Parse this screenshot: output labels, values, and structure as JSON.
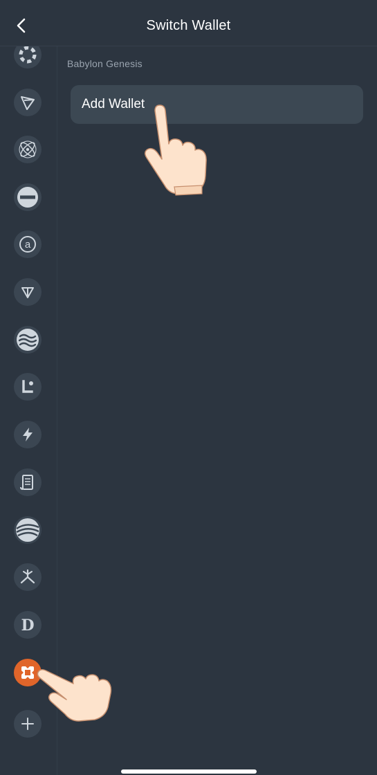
{
  "header": {
    "title": "Switch Wallet",
    "back_icon": "chevron-left-icon"
  },
  "sidebar": {
    "items": [
      {
        "name": "polkadot-icon",
        "active": false
      },
      {
        "name": "tron-icon",
        "active": false
      },
      {
        "name": "cosmos-atom-icon",
        "active": false
      },
      {
        "name": "minus-circle-icon",
        "active": false
      },
      {
        "name": "at-sign-icon",
        "active": false
      },
      {
        "name": "ton-triangle-icon",
        "active": false
      },
      {
        "name": "waves-icon",
        "active": false
      },
      {
        "name": "lisk-icon",
        "active": false
      },
      {
        "name": "lightning-icon",
        "active": false
      },
      {
        "name": "scroll-icon",
        "active": false
      },
      {
        "name": "swoosh-icon",
        "active": false
      },
      {
        "name": "propeller-icon",
        "active": false
      },
      {
        "name": "dogecoin-d-icon",
        "active": false
      },
      {
        "name": "babylon-icon",
        "active": true
      },
      {
        "name": "plus-icon",
        "active": false
      }
    ]
  },
  "main": {
    "section_label": "Babylon Genesis",
    "add_wallet_label": "Add Wallet"
  },
  "colors": {
    "background": "#2c3540",
    "card": "#3c4853",
    "icon_bg": "#3b4652",
    "icon_fg": "#cfd6dd",
    "active": "#e0652a",
    "muted_text": "#9aa4af"
  }
}
